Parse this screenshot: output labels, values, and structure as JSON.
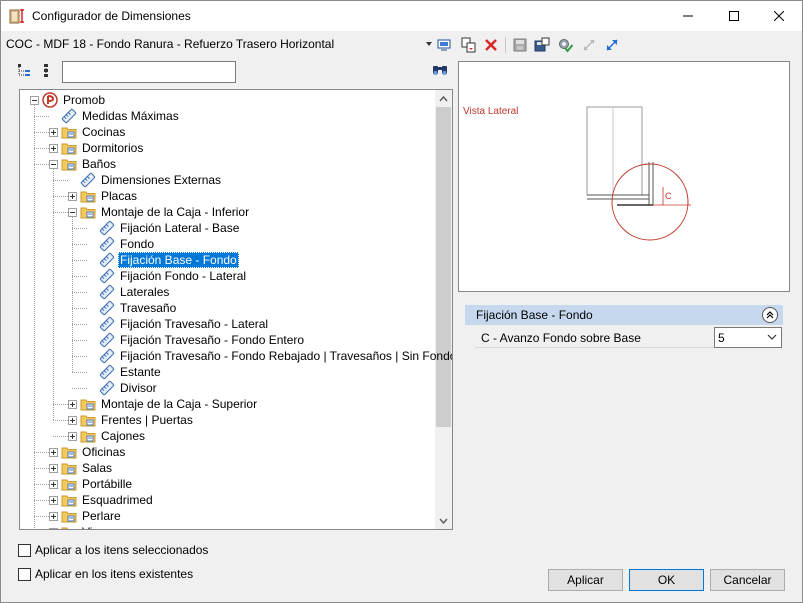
{
  "window": {
    "title": "Configurador de Dimensiones"
  },
  "toolbar": {
    "config_value": "COC - MDF 18 - Fondo Ranura - Refuerzo Trasero Horizontal",
    "icons": [
      "monitor-icon",
      "copy-icon",
      "delete-icon",
      "save-icon",
      "save-as-icon",
      "settings-check-icon",
      "collapse-icon",
      "expand-icon"
    ]
  },
  "search": {
    "value": "",
    "placeholder": ""
  },
  "tree": {
    "root": "Promob",
    "items": [
      {
        "label": "Medidas Máximas"
      },
      {
        "label": "Cocinas"
      },
      {
        "label": "Dormitorios"
      },
      {
        "label": "Baños"
      },
      {
        "label": "Dimensiones Externas"
      },
      {
        "label": "Placas"
      },
      {
        "label": "Montaje de la Caja - Inferior"
      },
      {
        "label": "Fijación Lateral - Base"
      },
      {
        "label": "Fondo"
      },
      {
        "label": "Fijación Base - Fondo"
      },
      {
        "label": "Fijación Fondo - Lateral"
      },
      {
        "label": "Laterales"
      },
      {
        "label": "Travesaño"
      },
      {
        "label": "Fijación Travesaño - Lateral"
      },
      {
        "label": "Fijación Travesaño - Fondo Entero"
      },
      {
        "label": "Fijación Travesaño - Fondo Rebajado | Travesaños | Sin Fondo"
      },
      {
        "label": "Estante"
      },
      {
        "label": "Divisor"
      },
      {
        "label": "Montaje de la Caja - Superior"
      },
      {
        "label": "Frentes | Puertas"
      },
      {
        "label": "Cajones"
      },
      {
        "label": "Oficinas"
      },
      {
        "label": "Salas"
      },
      {
        "label": "Portábille"
      },
      {
        "label": "Esquadrimed"
      },
      {
        "label": "Perlare"
      },
      {
        "label": "Vi..."
      }
    ],
    "selected": "Fijación Base - Fondo"
  },
  "preview": {
    "label": "Vista Lateral",
    "dimension_letter": "C",
    "accent_color": "#c0392b"
  },
  "properties": {
    "group_title": "Fijación Base - Fondo",
    "rows": [
      {
        "name": "C - Avanzo Fondo sobre Base",
        "value": "5"
      }
    ]
  },
  "options": {
    "apply_selected": "Aplicar a los itens seleccionados",
    "apply_existing": "Aplicar en los itens existentes"
  },
  "buttons": {
    "apply": "Aplicar",
    "ok": "OK",
    "cancel": "Cancelar"
  }
}
